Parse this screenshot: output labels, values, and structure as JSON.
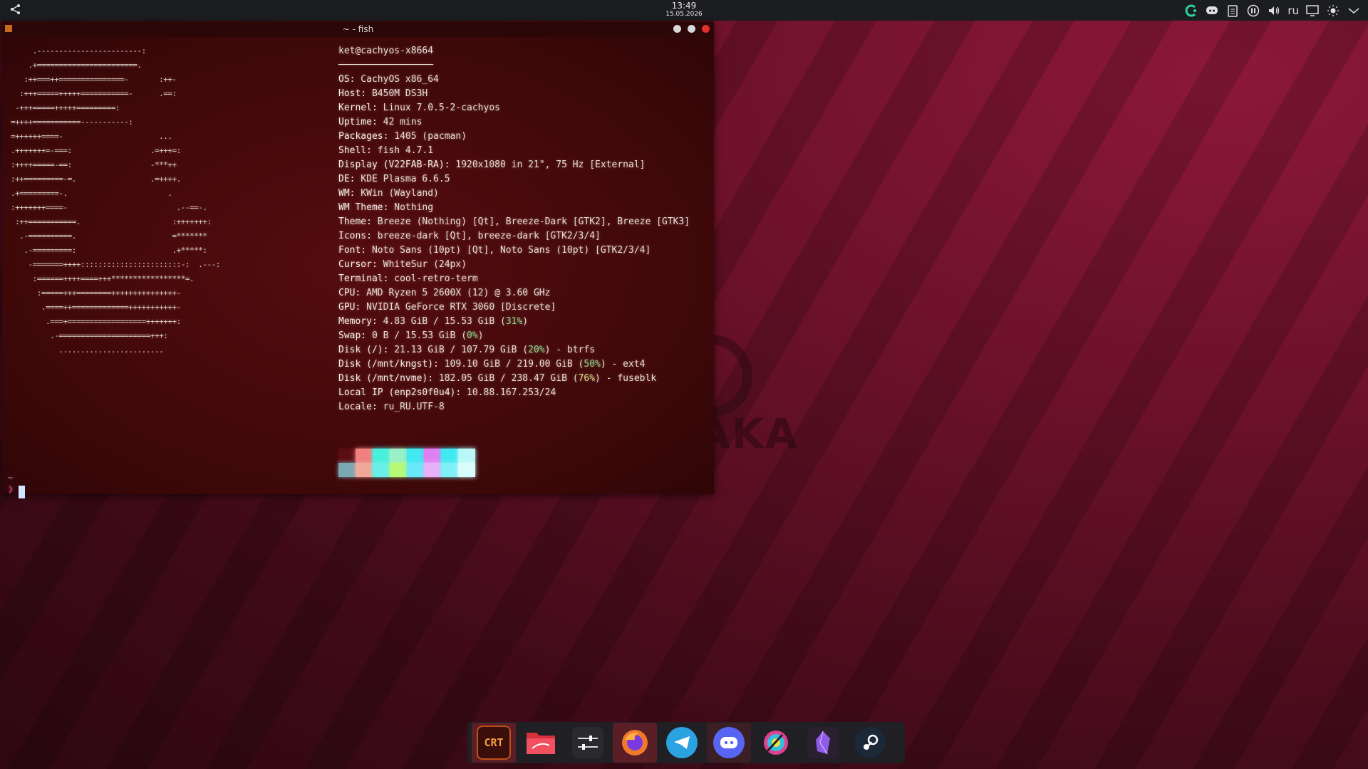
{
  "panel": {
    "clock_time": "13:49",
    "clock_date": "15.05.2026",
    "language": "ru",
    "tray_icons": [
      "cachyos-update-icon",
      "discord-icon",
      "clipboard-icon",
      "media-pause-icon",
      "volume-icon",
      "display-icon",
      "brightness-icon",
      "chevron-down-icon"
    ]
  },
  "terminal": {
    "title": "~ - fish",
    "ascii_logo": "     .------------------------:\n    .+=======================.\n   :++===++===============-       :++-\n  :+++=====+++++===========-      .==:\n -+++=====+++++=========:\n=++++===========-----------:\n=++++++====-                      ...\n.+++++++=-===:                  .=+++=:\n:++++=====-==:                  -***++\n:++=========-=.                 .=++++.\n.+=========-.                       .\n:+++++++====-                         .--==-.\n :++===========.                     :+++++++:\n  .-==========.                      =*******\n   .-=========:                      .+*****:\n    -=======++++:::::::::::::::::::::::-:  .---:\n     :======++++====+++*****************=.\n      :=====+++========+++++++++++++++-\n       .====++=============+++++++++++-\n        .===+==================+++++++:\n         .-=====================+++:\n           ........................",
    "user_host": "ket@cachyos-x8664",
    "separator": "─────────────────",
    "info": [
      {
        "key": "OS:",
        "value": " CachyOS x86_64"
      },
      {
        "key": "Host:",
        "value": " B450M DS3H"
      },
      {
        "key": "Kernel:",
        "value": " Linux 7.0.5-2-cachyos"
      },
      {
        "key": "Uptime:",
        "value": " 42 mins"
      },
      {
        "key": "Packages:",
        "value": " 1405 (pacman)"
      },
      {
        "key": "Shell:",
        "value": " fish 4.7.1"
      },
      {
        "key": "Display (V22FAB-RA):",
        "value": " 1920x1080 in 21\", 75 Hz [External]"
      },
      {
        "key": "DE:",
        "value": " KDE Plasma 6.6.5"
      },
      {
        "key": "WM:",
        "value": " KWin (Wayland)"
      },
      {
        "key": "WM Theme:",
        "value": " Nothing"
      },
      {
        "key": "Theme:",
        "value": " Breeze (Nothing) [Qt], Breeze-Dark [GTK2], Breeze [GTK3]"
      },
      {
        "key": "Icons:",
        "value": " breeze-dark [Qt], breeze-dark [GTK2/3/4]"
      },
      {
        "key": "Font:",
        "value": " Noto Sans (10pt) [Qt], Noto Sans (10pt) [GTK2/3/4]"
      },
      {
        "key": "Cursor:",
        "value": " WhiteSur (24px)"
      },
      {
        "key": "Terminal:",
        "value": " cool-retro-term"
      },
      {
        "key": "CPU:",
        "value": " AMD Ryzen 5 2600X (12) @ 3.60 GHz"
      },
      {
        "key": "GPU:",
        "value": " NVIDIA GeForce RTX 3060 [Discrete]"
      },
      {
        "key": "Memory:",
        "value": " 4.83 GiB / 15.53 GiB (",
        "hl": "31%",
        "hl_class": "hl",
        "tail": ")"
      },
      {
        "key": "Swap:",
        "value": " 0 B / 15.53 GiB (",
        "hl": "0%",
        "hl_class": "hl",
        "tail": ")"
      },
      {
        "key": "Disk (/):",
        "value": " 21.13 GiB / 107.79 GiB (",
        "hl": "20%",
        "hl_class": "hl",
        "tail": ") - btrfs"
      },
      {
        "key": "Disk (/mnt/kngst):",
        "value": " 109.10 GiB / 219.00 GiB (",
        "hl": "50%",
        "hl_class": "hl",
        "tail": ") - ext4"
      },
      {
        "key": "Disk (/mnt/nvme):",
        "value": " 182.05 GiB / 238.47 GiB (",
        "hl": "76%",
        "hl_class": "hl-y",
        "tail": ") - fuseblk"
      },
      {
        "key": "Local IP (enp2s0f0u4):",
        "value": " 10.88.167.253/24"
      },
      {
        "key": "Locale:",
        "value": " ru_RU.UTF-8"
      }
    ],
    "palette_row1": [
      "#5a0d12",
      "#f08080",
      "#48f0dc",
      "#9af0c8",
      "#40e8f0",
      "#e080f0",
      "#40e8f0",
      "#b8f8f8"
    ],
    "palette_row2": [
      "#7aa8b0",
      "#f0a898",
      "#68f0e8",
      "#b8f878",
      "#68e8f8",
      "#e8b0f8",
      "#80f0f8",
      "#d8fcfc"
    ],
    "prompt_tilde": "~",
    "prompt_arrow": "❯"
  },
  "dock": {
    "items": [
      {
        "name": "cool-retro-term",
        "label": "CRT",
        "color": "#6b1a10"
      },
      {
        "name": "file-manager",
        "label": "",
        "color": "#d8303a"
      },
      {
        "name": "system-settings",
        "label": "",
        "color": "#2a2a2e"
      },
      {
        "name": "firefox",
        "label": "",
        "color": "#f0883a"
      },
      {
        "name": "telegram",
        "label": "",
        "color": "#2aa3e0"
      },
      {
        "name": "discord",
        "label": "",
        "color": "#5865f2"
      },
      {
        "name": "krita",
        "label": "",
        "color": "#3a3a3a"
      },
      {
        "name": "obsidian",
        "label": "",
        "color": "#2a2030"
      },
      {
        "name": "steam",
        "label": "",
        "color": "#1b2838"
      }
    ]
  }
}
